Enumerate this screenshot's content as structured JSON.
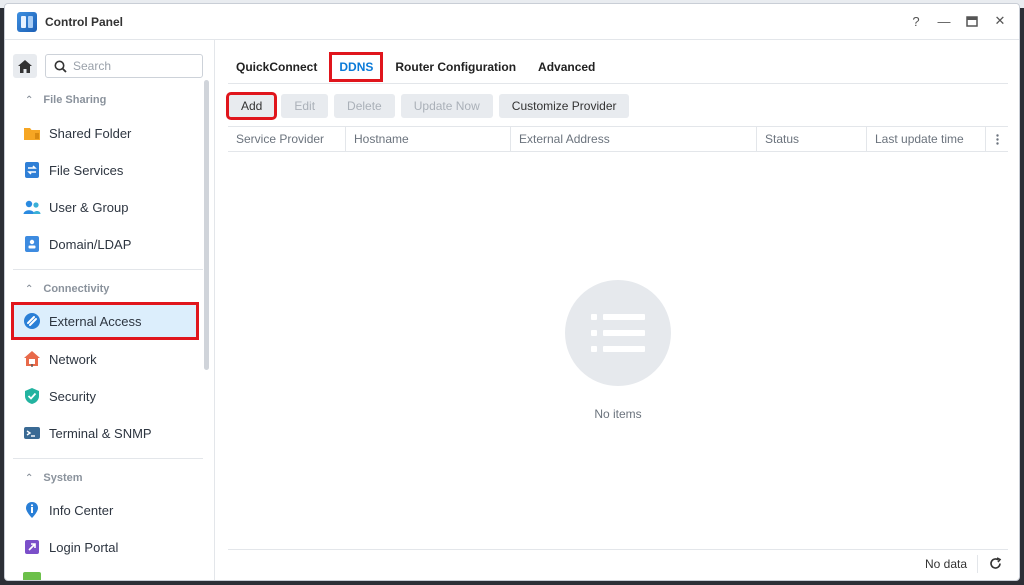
{
  "window": {
    "title": "Control Panel"
  },
  "search": {
    "placeholder": "Search"
  },
  "sidebar": {
    "sections": [
      {
        "label": "File Sharing"
      },
      {
        "label": "Connectivity"
      },
      {
        "label": "System"
      }
    ],
    "items": [
      {
        "label": "Shared Folder",
        "icon": "folder-icon"
      },
      {
        "label": "File Services",
        "icon": "file-services-icon"
      },
      {
        "label": "User & Group",
        "icon": "user-group-icon"
      },
      {
        "label": "Domain/LDAP",
        "icon": "domain-icon"
      },
      {
        "label": "External Access",
        "icon": "external-access-icon",
        "active": true
      },
      {
        "label": "Network",
        "icon": "network-icon"
      },
      {
        "label": "Security",
        "icon": "shield-icon"
      },
      {
        "label": "Terminal & SNMP",
        "icon": "terminal-icon"
      },
      {
        "label": "Info Center",
        "icon": "info-icon"
      },
      {
        "label": "Login Portal",
        "icon": "login-portal-icon"
      }
    ]
  },
  "tabs": [
    {
      "label": "QuickConnect"
    },
    {
      "label": "DDNS",
      "active": true
    },
    {
      "label": "Router Configuration"
    },
    {
      "label": "Advanced"
    }
  ],
  "toolbar": {
    "add": "Add",
    "edit": "Edit",
    "delete": "Delete",
    "update_now": "Update Now",
    "customize_provider": "Customize Provider"
  },
  "table": {
    "columns": [
      "Service Provider",
      "Hostname",
      "External Address",
      "Status",
      "Last update time"
    ],
    "empty_text": "No items"
  },
  "footer": {
    "status": "No data"
  },
  "colors": {
    "accent": "#0a7ad8",
    "highlight": "#e0151c",
    "active_bg": "#dceefc"
  }
}
